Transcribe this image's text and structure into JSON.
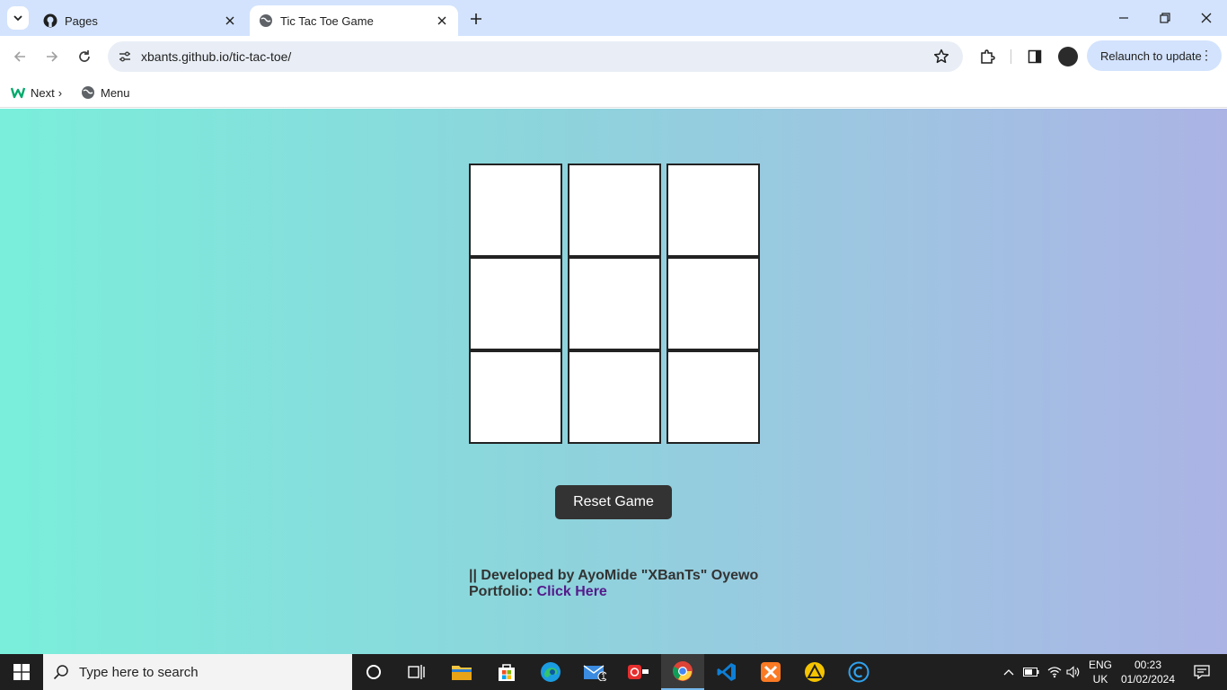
{
  "browser": {
    "tabs": [
      {
        "title": "Pages",
        "active": false
      },
      {
        "title": "Tic Tac Toe Game",
        "active": true
      }
    ],
    "url": "xbants.github.io/tic-tac-toe/",
    "relaunch_label": "Relaunch to update",
    "bookmarks": [
      {
        "label": "Next"
      },
      {
        "label": "Menu"
      }
    ]
  },
  "game": {
    "cells": [
      "",
      "",
      "",
      "",
      "",
      "",
      "",
      "",
      ""
    ],
    "reset_label": "Reset Game",
    "credit_line": "|| Developed by AyoMide \"XBanTs\" Oyewo",
    "portfolio_label": "Portfolio:",
    "portfolio_link": "Click Here"
  },
  "taskbar": {
    "search_placeholder": "Type here to search",
    "lang_top": "ENG",
    "lang_bottom": "UK",
    "time": "00:23",
    "date": "01/02/2024",
    "mail_badge": "1"
  },
  "colors": {
    "gradient_start": "#7aeedb",
    "gradient_end": "#abb3e5",
    "reset_bg": "#333333",
    "link": "#551a8b"
  }
}
